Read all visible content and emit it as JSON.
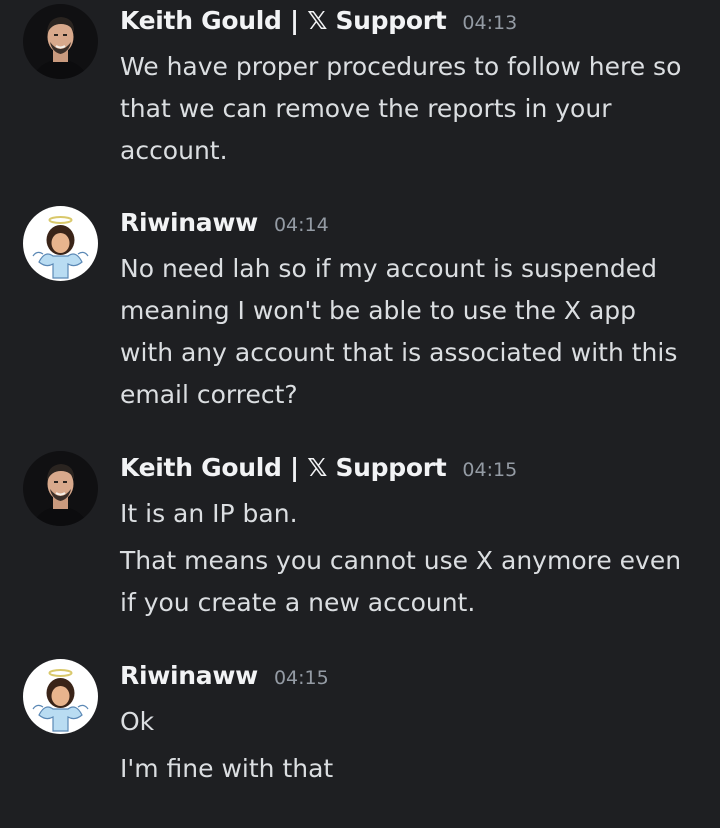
{
  "messages": [
    {
      "author": "Keith Gould | 𝕏 Support",
      "time": "04:13",
      "lines": [
        "We have proper procedures to follow here so",
        "that we can remove the reports in your",
        "account."
      ]
    },
    {
      "author": "Riwinaww",
      "time": "04:14",
      "lines": [
        "No need lah so if my account is suspended",
        "meaning I won't be able to use the X app",
        "with any account that is associated with this",
        "email correct?"
      ]
    },
    {
      "author": "Keith Gould | 𝕏 Support",
      "time": "04:15",
      "lines": [
        "It is an IP ban."
      ],
      "lines2": [
        "That means you cannot use X anymore even",
        "if you create a new account."
      ]
    },
    {
      "author": "Riwinaww",
      "time": "04:15",
      "lines": [
        "Ok"
      ],
      "lines2": [
        "I'm fine with that"
      ]
    }
  ],
  "colors": {
    "background": "#1e1f22",
    "author": "#f2f3f5",
    "timestamp": "#949ba4",
    "text": "#dbdee1"
  }
}
